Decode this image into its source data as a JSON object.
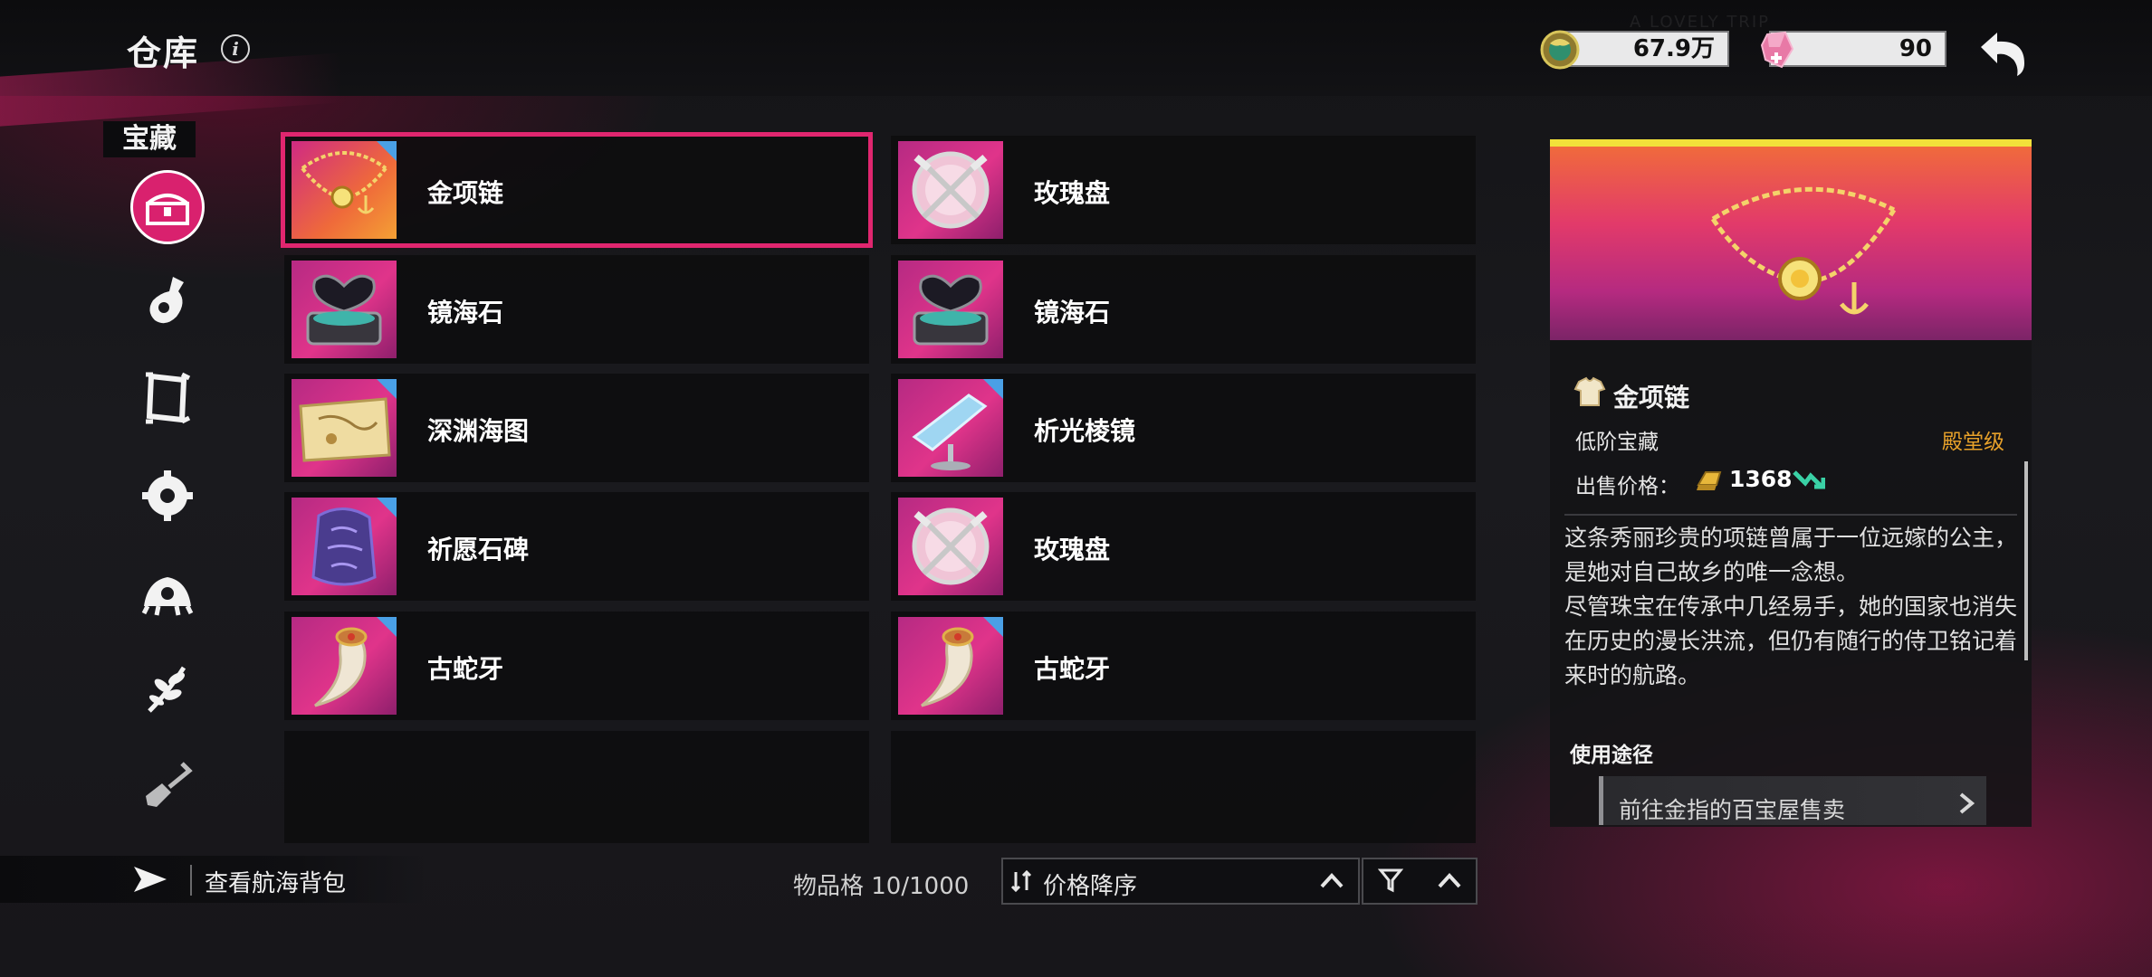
{
  "header": {
    "title": "仓库",
    "info_icon": "info-icon",
    "watermark": "A LOVELY TRIP",
    "currencies": [
      {
        "icon": "gold-dragon-coin-icon",
        "value": "67.9万"
      },
      {
        "icon": "pink-gem-icon",
        "value": "90"
      }
    ],
    "back_icon": "back-arrow-icon"
  },
  "categories": {
    "active_label": "宝藏",
    "items": [
      {
        "name": "treasure-chest-icon",
        "active": true
      },
      {
        "name": "potion-bottle-icon",
        "active": false
      },
      {
        "name": "picture-frame-icon",
        "active": false
      },
      {
        "name": "gear-icon",
        "active": false
      },
      {
        "name": "sea-creature-icon",
        "active": false
      },
      {
        "name": "plant-sprig-icon",
        "active": false
      },
      {
        "name": "shovel-icon",
        "active": false
      }
    ]
  },
  "items": [
    {
      "name": "金项链",
      "icon": "gold-necklace-icon",
      "selected": true
    },
    {
      "name": "玫瑰盘",
      "icon": "rose-plate-icon",
      "selected": false
    },
    {
      "name": "镜海石",
      "icon": "mirror-sea-stone-icon",
      "selected": false
    },
    {
      "name": "镜海石",
      "icon": "mirror-sea-stone-icon",
      "selected": false
    },
    {
      "name": "深渊海图",
      "icon": "abyss-sea-map-icon",
      "selected": false
    },
    {
      "name": "析光棱镜",
      "icon": "prism-icon",
      "selected": false
    },
    {
      "name": "祈愿石碑",
      "icon": "prayer-stone-icon",
      "selected": false
    },
    {
      "name": "玫瑰盘",
      "icon": "rose-plate-icon",
      "selected": false
    },
    {
      "name": "古蛇牙",
      "icon": "serpent-fang-icon",
      "selected": false
    },
    {
      "name": "古蛇牙",
      "icon": "serpent-fang-icon",
      "selected": false
    }
  ],
  "footer": {
    "bag_label": "查看航海背包",
    "capacity": "物品格 10/1000",
    "sort_label": "价格降序"
  },
  "detail": {
    "name": "金项链",
    "type": "低阶宝藏",
    "rank": "殿堂级",
    "price_label": "出售价格：",
    "price": "1368",
    "description": "这条秀丽珍贵的项链曾属于一位远嫁的公主，是她对自己故乡的唯一念想。\n尽管珠宝在传承中几经易手，她的国家也消失在历史的漫长洪流，但仍有随行的侍卫铭记着来时的航路。",
    "use_title": "使用途径",
    "use_item": "前往金指的百宝屋售卖"
  },
  "colors": {
    "accent": "#e0266f",
    "rank": "#e7a12a",
    "detail_top_line": "#f2e13a"
  }
}
